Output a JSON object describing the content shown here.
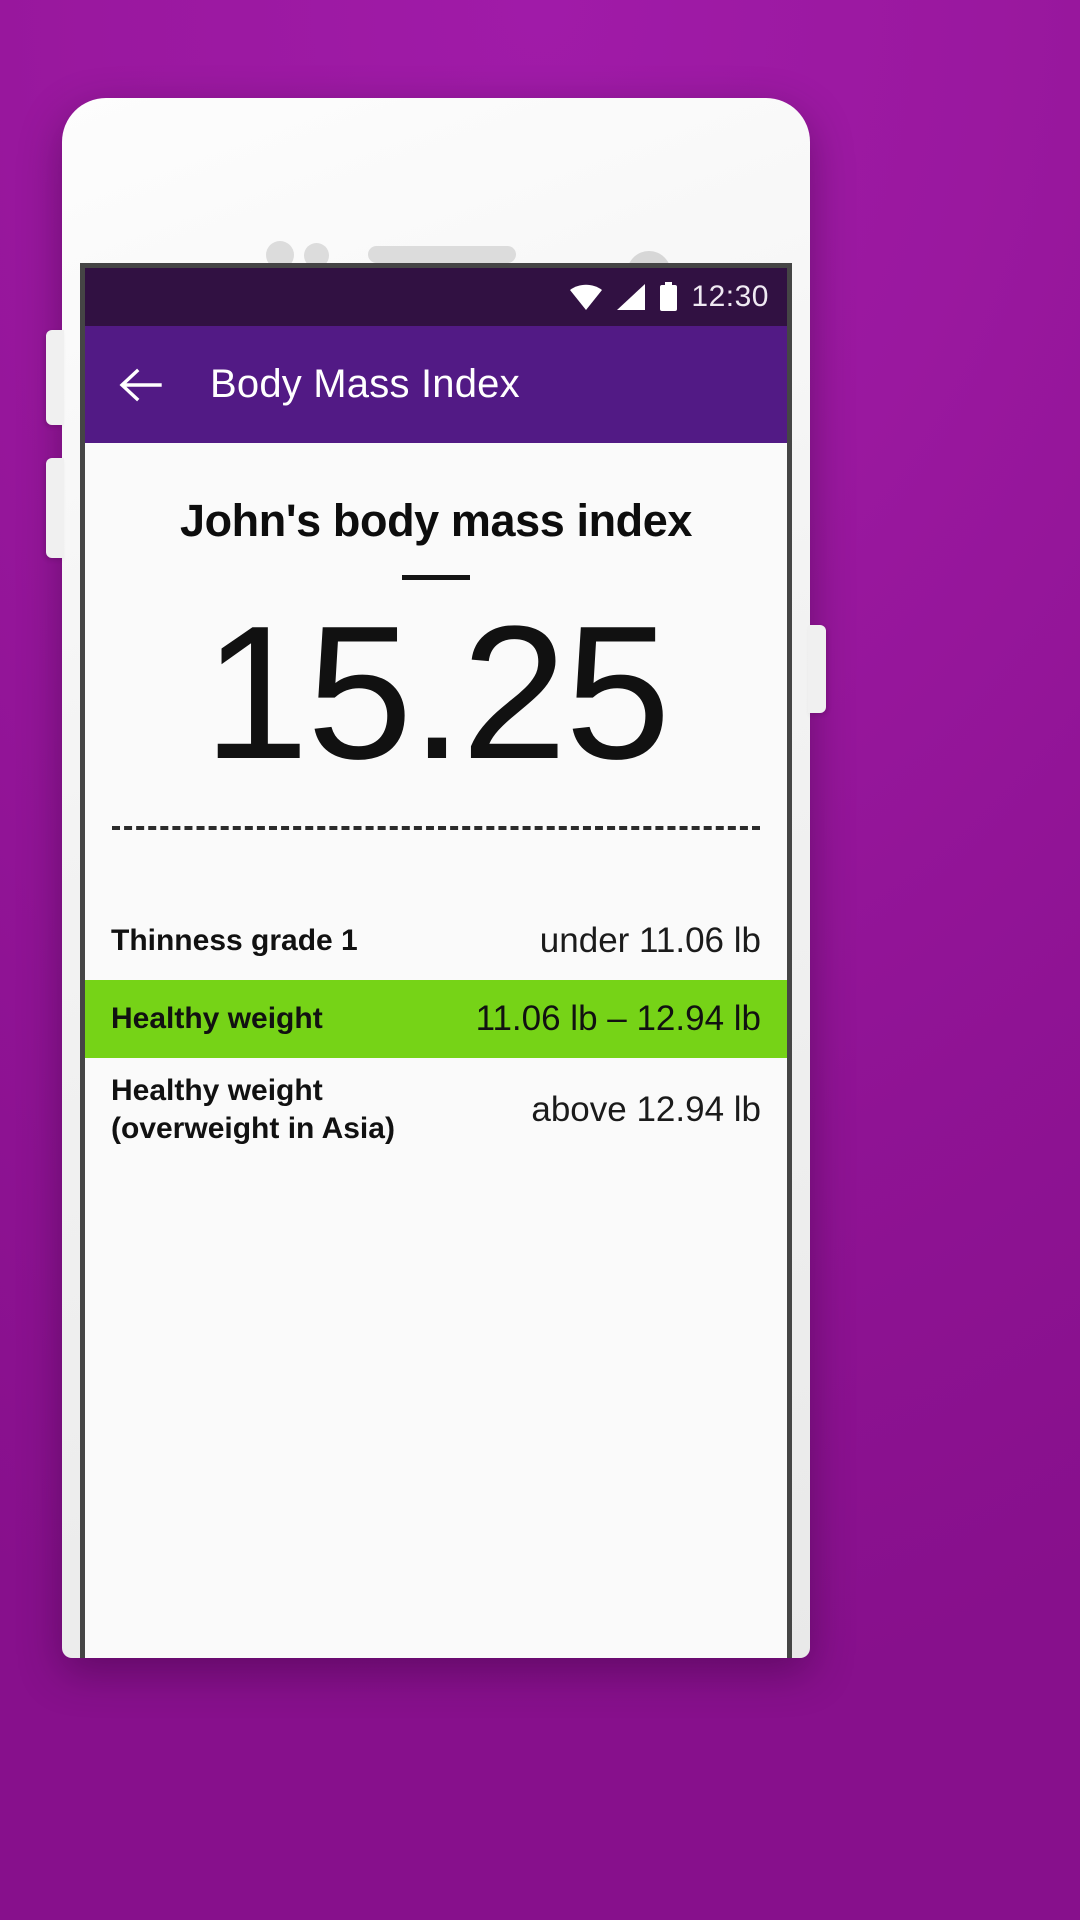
{
  "statusbar": {
    "time": "12:30",
    "icons": [
      "wifi-icon",
      "cell-signal-icon",
      "battery-icon"
    ]
  },
  "appbar": {
    "back_label": "back-arrow-icon",
    "title": "Body Mass Index",
    "background_color": "#521a85",
    "statusbar_color": "#311142"
  },
  "result": {
    "title": "John's body mass index",
    "value": "15.25"
  },
  "categories": {
    "highlight_color": "#76d317",
    "rows": [
      {
        "label": "Thinness grade 1",
        "value": "under 11.06 lb",
        "highlighted": false
      },
      {
        "label": "Healthy weight",
        "value": "11.06 lb – 12.94 lb",
        "highlighted": true
      },
      {
        "label": "Healthy weight\n(overweight in Asia)",
        "value": "above 12.94 lb",
        "highlighted": false
      }
    ]
  },
  "device": {
    "frame_color": "#f3f3f3",
    "background_color": "#9a189f"
  }
}
